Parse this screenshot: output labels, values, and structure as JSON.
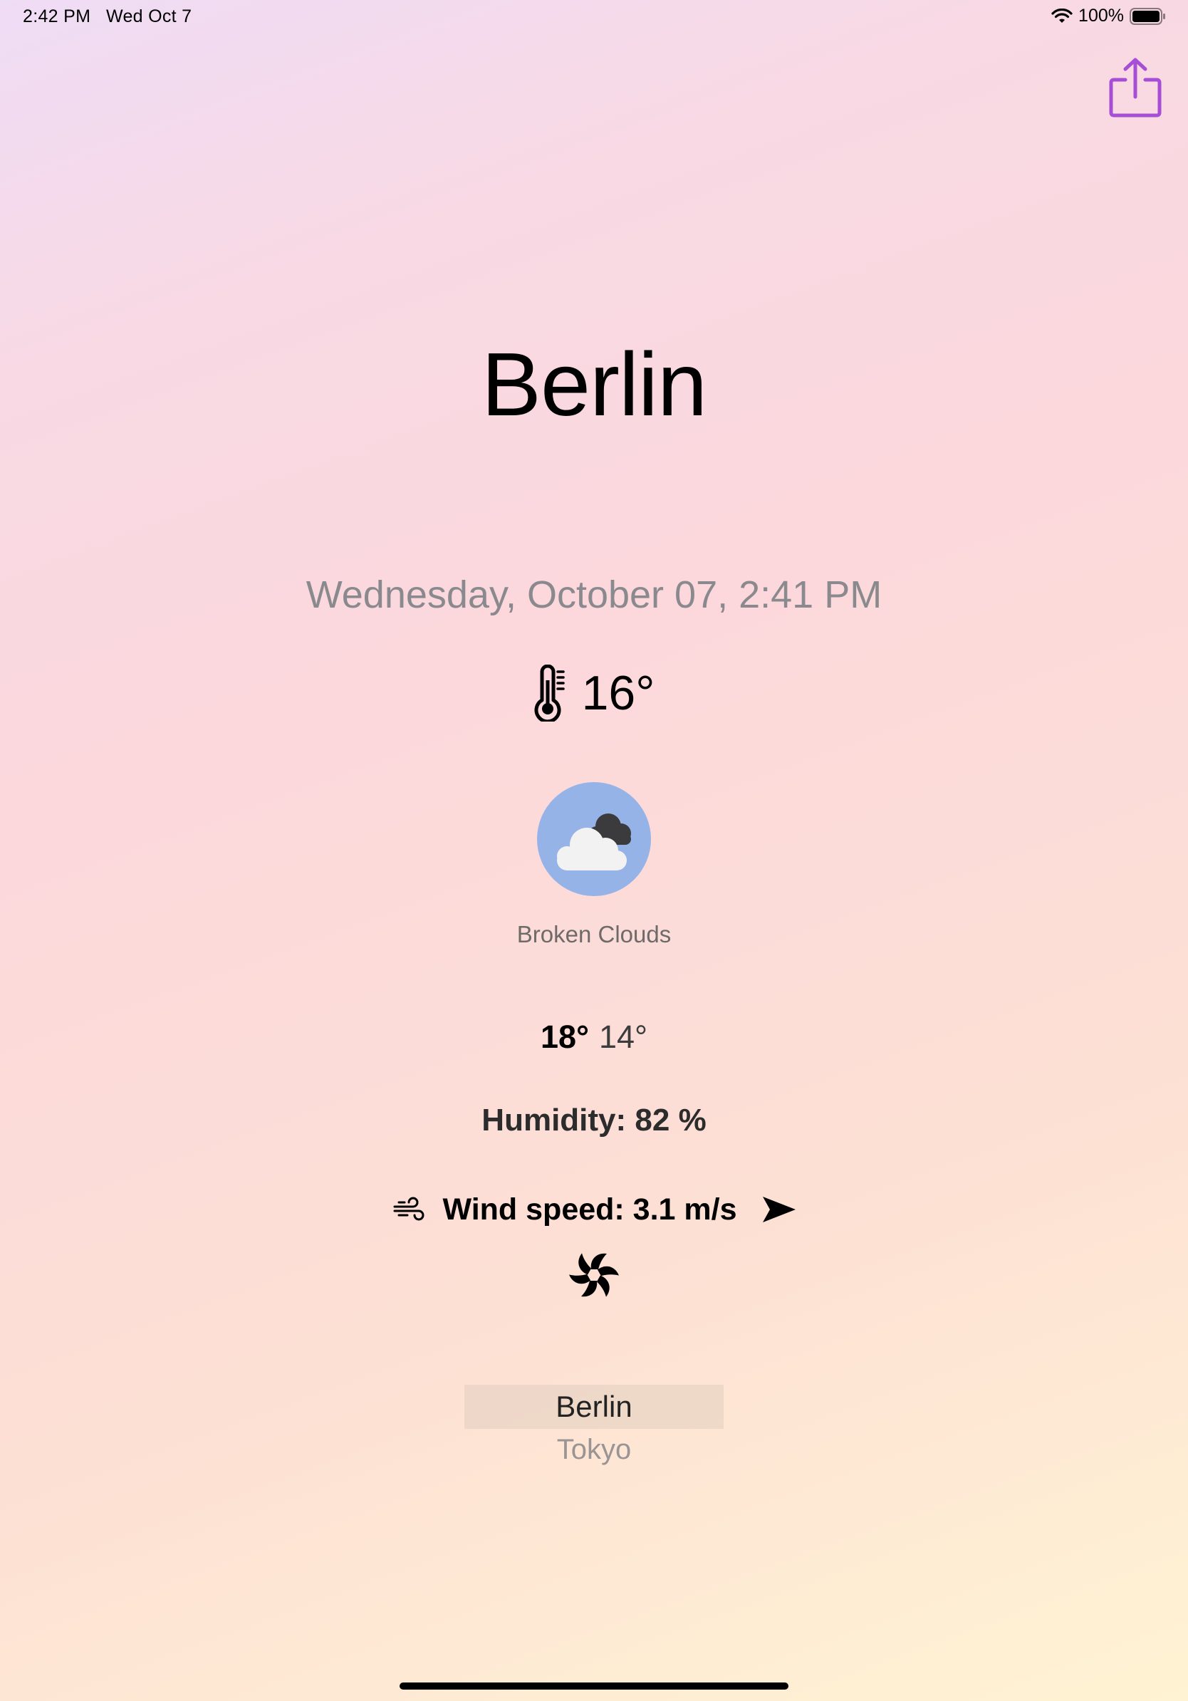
{
  "status_bar": {
    "time": "2:42 PM",
    "date": "Wed Oct 7",
    "battery": "100%"
  },
  "city": "Berlin",
  "datetime": "Wednesday, October 07, 2:41 PM",
  "temperature": "16°",
  "condition": "Broken Clouds",
  "temp_max": "18°",
  "temp_min": "14°",
  "humidity": "Humidity: 82 %",
  "wind": "Wind speed: 3.1 m/s",
  "picker": {
    "selected": "Berlin",
    "options": [
      "Tokyo"
    ]
  },
  "colors": {
    "accent": "#a64fd6",
    "weather_icon_bg": "#96b3e8",
    "secondary_text": "#8a8a8e"
  },
  "icons": {
    "share": "share-icon",
    "thermometer": "thermometer-icon",
    "weather": "broken-clouds-icon",
    "wind": "wind-icon",
    "direction": "paperplane-direction-icon",
    "fan": "fan-icon"
  }
}
